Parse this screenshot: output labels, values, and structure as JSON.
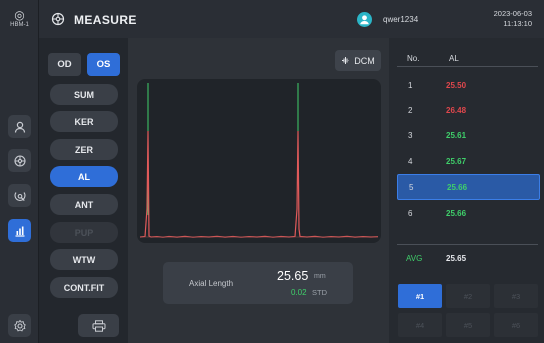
{
  "device": {
    "label": "HBM-1"
  },
  "header": {
    "title": "MEASURE",
    "username": "qwer1234",
    "date": "2023-06-03",
    "time": "11:13:10"
  },
  "colors": {
    "accent": "#2f6ed8",
    "red_value": "#e0474c",
    "green_value": "#3fcf6a",
    "waveform": "#e05a5a"
  },
  "rail": {
    "icons": [
      "device-icon",
      "user-icon",
      "measure-gear-icon",
      "eye-scan-icon",
      "chart-icon",
      "settings-icon"
    ]
  },
  "controls": {
    "eye_toggle": {
      "od": "OD",
      "os": "OS",
      "selected": "OS"
    },
    "functions": [
      {
        "label": "SUM",
        "state": "normal"
      },
      {
        "label": "KER",
        "state": "normal"
      },
      {
        "label": "ZER",
        "state": "normal"
      },
      {
        "label": "AL",
        "state": "active"
      },
      {
        "label": "ANT",
        "state": "normal"
      },
      {
        "label": "PUP",
        "state": "disabled"
      },
      {
        "label": "WTW",
        "state": "normal"
      },
      {
        "label": "CONT.FIT",
        "state": "normal"
      }
    ]
  },
  "scan": {
    "dcm_label": "DCM",
    "readout_label": "Axial Length",
    "value": "25.65",
    "unit": "mm",
    "std_value": "0.02",
    "std_label": "STD"
  },
  "measurements": {
    "headers": {
      "no": "No.",
      "al": "AL"
    },
    "rows": [
      {
        "no": "1",
        "al": "25.50",
        "status": "red"
      },
      {
        "no": "2",
        "al": "26.48",
        "status": "red"
      },
      {
        "no": "3",
        "al": "25.61",
        "status": "green"
      },
      {
        "no": "4",
        "al": "25.67",
        "status": "green"
      },
      {
        "no": "5",
        "al": "25.66",
        "status": "green",
        "selected": true
      },
      {
        "no": "6",
        "al": "25.66",
        "status": "green"
      }
    ],
    "avg_label": "AVG",
    "avg_value": "25.65",
    "slots": [
      "#1",
      "#2",
      "#3",
      "#4",
      "#5",
      "#6"
    ],
    "active_slot": "#1"
  }
}
